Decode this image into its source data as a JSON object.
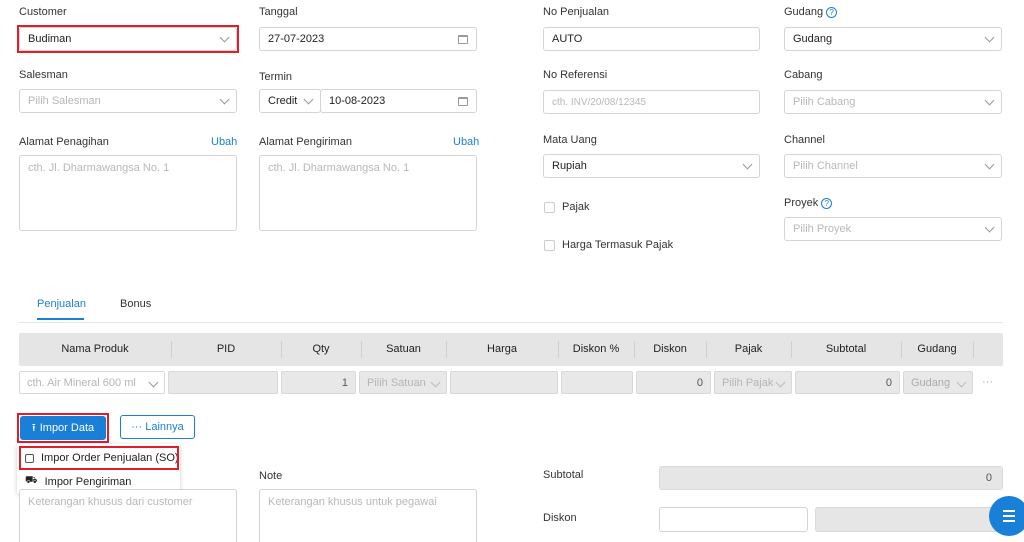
{
  "form": {
    "customer": {
      "label": "Customer",
      "value": "Budiman"
    },
    "tanggal": {
      "label": "Tanggal",
      "value": "27-07-2023"
    },
    "no_penjualan": {
      "label": "No Penjualan",
      "value": "AUTO"
    },
    "gudang": {
      "label": "Gudang",
      "value": "Gudang"
    },
    "salesman": {
      "label": "Salesman",
      "placeholder": "Pilih Salesman"
    },
    "termin": {
      "label": "Termin",
      "type": "Credit",
      "date": "10-08-2023"
    },
    "no_referensi": {
      "label": "No Referensi",
      "placeholder": "cth. INV/20/08/12345"
    },
    "cabang": {
      "label": "Cabang",
      "placeholder": "Pilih Cabang"
    },
    "alamat_penagihan": {
      "label": "Alamat Penagihan",
      "link": "Ubah",
      "placeholder": "cth. Jl. Dharmawangsa No. 1"
    },
    "alamat_pengiriman": {
      "label": "Alamat Pengiriman",
      "link": "Ubah",
      "placeholder": "cth. Jl. Dharmawangsa No. 1"
    },
    "mata_uang": {
      "label": "Mata Uang",
      "value": "Rupiah"
    },
    "channel": {
      "label": "Channel",
      "placeholder": "Pilih Channel"
    },
    "pajak": {
      "label": "Pajak"
    },
    "harga_termasuk_pajak": {
      "label": "Harga Termasuk Pajak"
    },
    "proyek": {
      "label": "Proyek",
      "placeholder": "Pilih Proyek"
    }
  },
  "tabs": {
    "active": "Penjualan",
    "other": "Bonus"
  },
  "table": {
    "headers": [
      "Nama Produk",
      "PID",
      "Qty",
      "Satuan",
      "Harga",
      "Diskon %",
      "Diskon",
      "Pajak",
      "Subtotal",
      "Gudang"
    ],
    "row": {
      "produk_placeholder": "cth. Air Mineral 600 ml",
      "qty": "1",
      "satuan_placeholder": "Pilih Satuan",
      "diskon": "0",
      "pajak_placeholder": "Pilih Pajak",
      "subtotal": "0",
      "gudang": "Gudang",
      "more": "···"
    }
  },
  "buttons": {
    "impor_data": "Impor Data",
    "lainnya": "··· Lainnya"
  },
  "impor_menu": {
    "item1": "Impor Order Penjualan (SO)",
    "item2": "Impor Pengiriman"
  },
  "bottom": {
    "note_label": "Note",
    "note_placeholder": "Keterangan khusus untuk pegawai",
    "customer_note_placeholder": "Keterangan khusus dari customer",
    "subtotal_label": "Subtotal",
    "subtotal_value": "0",
    "diskon_label": "Diskon"
  },
  "colors": {
    "accent": "#1a7fd6",
    "highlight": "#e01e2a",
    "button": "#1a7fd6"
  }
}
